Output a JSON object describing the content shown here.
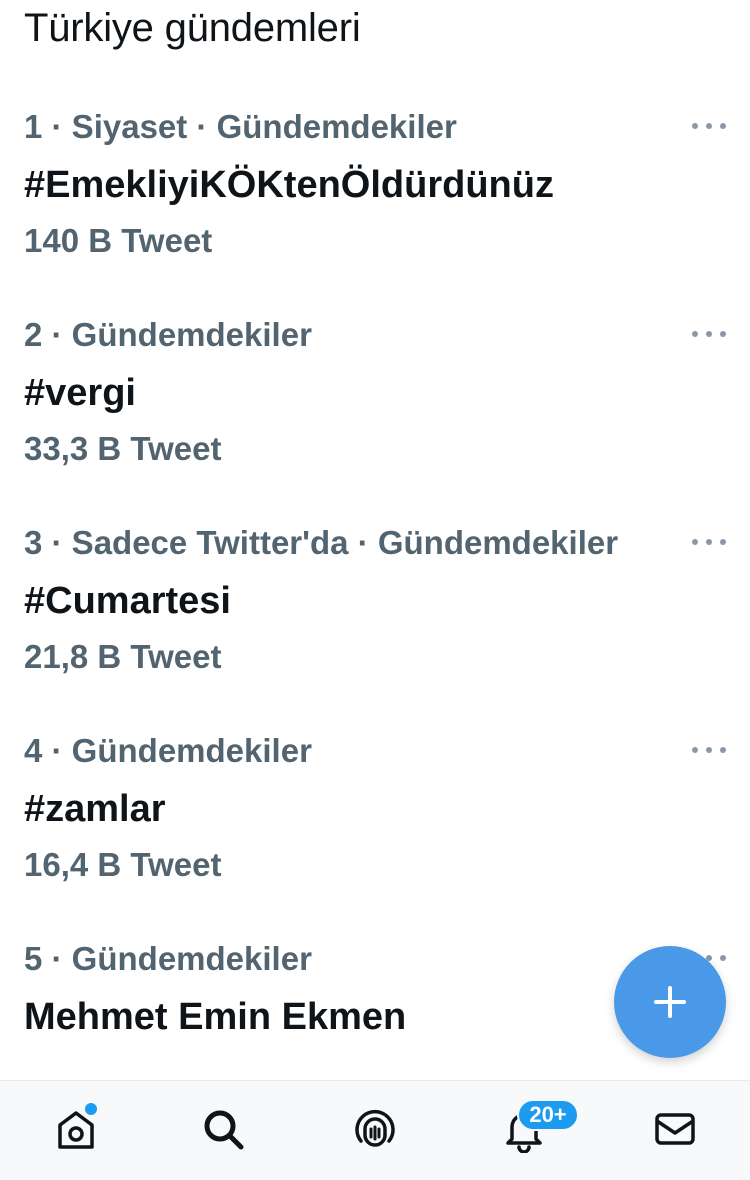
{
  "section_title": "Türkiye gündemleri",
  "trends": [
    {
      "meta": "1 · Siyaset · Gündemdekiler",
      "name": "#EmekliyiKÖKtenÖldürdünüz",
      "count": "140 B Tweet"
    },
    {
      "meta": "2 · Gündemdekiler",
      "name": "#vergi",
      "count": "33,3 B Tweet"
    },
    {
      "meta": "3 · Sadece Twitter'da · Gündemdekiler",
      "name": "#Cumartesi",
      "count": "21,8 B Tweet"
    },
    {
      "meta": "4 · Gündemdekiler",
      "name": "#zamlar",
      "count": "16,4 B Tweet"
    },
    {
      "meta": "5 · Gündemdekiler",
      "name": "Mehmet Emin Ekmen",
      "count": ""
    }
  ],
  "tabbar": {
    "notifications_badge": "20+",
    "icons": [
      "home-icon",
      "search-icon",
      "spaces-icon",
      "bell-icon",
      "mail-icon"
    ]
  },
  "colors": {
    "accent": "#1d9bf0",
    "fab": "#4a99e9",
    "secondary_text": "#536471",
    "primary_text": "#0f1419"
  }
}
